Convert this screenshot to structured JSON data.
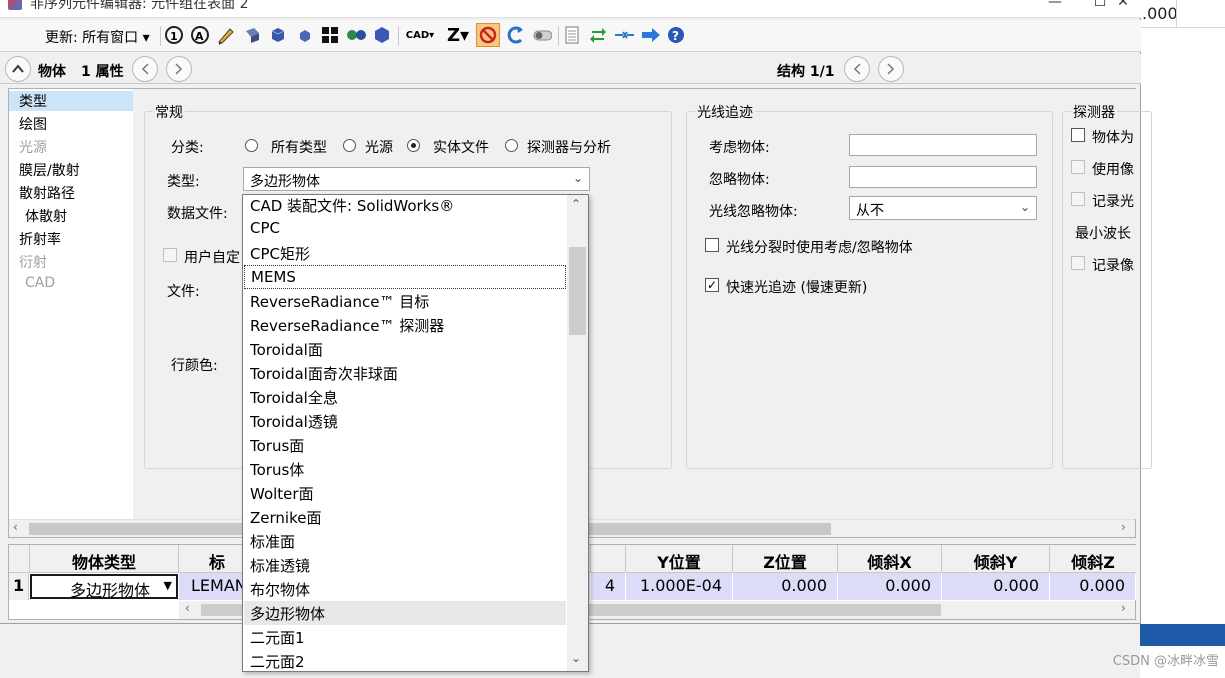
{
  "window": {
    "title": "非序列元件编辑器: 元件组在表面 2",
    "minimize": "—",
    "maximize": "☐",
    "close": "✕"
  },
  "toolbar": {
    "update_label": "更新: 所有窗口 ▾",
    "cad_label": "CAD▾",
    "z_label": "Z▾"
  },
  "object_bar": {
    "object_label": "物体",
    "property_label": "1 属性",
    "structure_label": "结构 1/1"
  },
  "side_nav": [
    {
      "label": "类型",
      "active": true,
      "disabled": false
    },
    {
      "label": "绘图",
      "active": false,
      "disabled": false
    },
    {
      "label": "光源",
      "active": false,
      "disabled": true
    },
    {
      "label": "膜层/散射",
      "active": false,
      "disabled": false
    },
    {
      "label": "散射路径",
      "active": false,
      "disabled": false
    },
    {
      "label": "体散射",
      "active": false,
      "disabled": false
    },
    {
      "label": "折射率",
      "active": false,
      "disabled": false
    },
    {
      "label": "衍射",
      "active": false,
      "disabled": true
    },
    {
      "label": "CAD",
      "active": false,
      "disabled": true
    }
  ],
  "general": {
    "title": "常规",
    "category_label": "分类:",
    "radios": [
      {
        "label": "所有类型",
        "checked": false
      },
      {
        "label": "光源",
        "checked": false
      },
      {
        "label": "实体文件",
        "checked": true
      },
      {
        "label": "探测器与分析",
        "checked": false
      }
    ],
    "type_label": "类型:",
    "type_value": "多边形物体",
    "data_file_label": "数据文件:",
    "user_defined_label": "用户自定",
    "file_label": "文件:",
    "row_color_label": "行颜色:"
  },
  "raytrace": {
    "title": "光线追迹",
    "consider_label": "考虑物体:",
    "consider_value": "",
    "ignore_label": "忽略物体:",
    "ignore_value": "",
    "ray_ignore_label": "光线忽略物体:",
    "ray_ignore_value": "从不",
    "split_label": "光线分裂时使用考虑/忽略物体",
    "split_checked": false,
    "fast_label": "快速光追迹 (慢速更新)",
    "fast_checked": true
  },
  "detector": {
    "title": "探测器",
    "items": [
      "物体为",
      "使用像",
      "记录光",
      "最小波长",
      "记录像"
    ]
  },
  "dropdown": {
    "items": [
      "CAD 装配文件: SolidWorks®",
      "CPC",
      "CPC矩形",
      "MEMS",
      "ReverseRadiance™ 目标",
      "ReverseRadiance™ 探测器",
      "Toroidal面",
      "Toroidal面奇次非球面",
      "Toroidal全息",
      "Toroidal透镜",
      "Torus面",
      "Torus体",
      "Wolter面",
      "Zernike面",
      "标准面",
      "标准透镜",
      "布尔物体",
      "多边形物体",
      "二元面1",
      "二元面2"
    ],
    "focused_index": 3,
    "selected_index": 17
  },
  "grid": {
    "headers": [
      "物体类型",
      "标",
      "",
      "Y位置",
      "Z位置",
      "倾斜X",
      "倾斜Y",
      "倾斜Z"
    ],
    "row_number": "1",
    "row": {
      "type": "多边形物体",
      "comment": "LEMAN",
      "x_partial": "4",
      "y": "1.000E-04",
      "z": "0.000",
      "tilt_x": "0.000",
      "tilt_y": "0.000",
      "tilt_z": "0.000"
    }
  },
  "background": {
    "cell_value": ".000",
    "watermark": "CSDN @冰畔冰雪"
  }
}
